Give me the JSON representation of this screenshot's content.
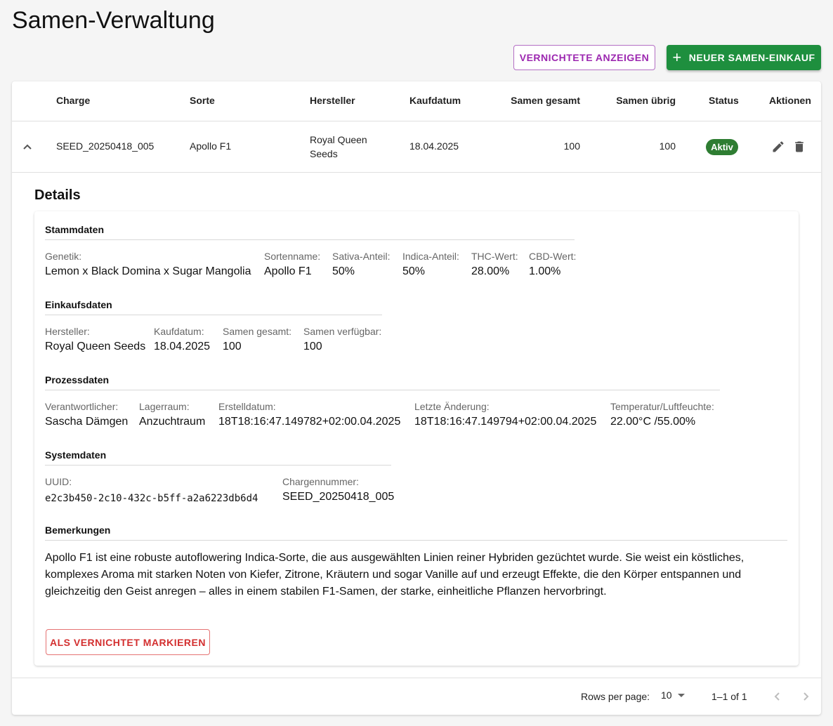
{
  "page": {
    "title": "Samen-Verwaltung"
  },
  "toolbar": {
    "show_destroyed_label": "Vernichtete anzeigen",
    "new_purchase_label": "Neuer Samen-Einkauf"
  },
  "table": {
    "headers": {
      "charge": "Charge",
      "sorte": "Sorte",
      "hersteller": "Hersteller",
      "kaufdatum": "Kaufdatum",
      "samen_gesamt": "Samen gesamt",
      "samen_uebrig": "Samen übrig",
      "status": "Status",
      "aktionen": "Aktionen"
    },
    "rows": [
      {
        "charge": "SEED_20250418_005",
        "sorte": "Apollo F1",
        "hersteller_line1": "Royal Queen",
        "hersteller_line2": "Seeds",
        "kaufdatum": "18.04.2025",
        "samen_gesamt": "100",
        "samen_uebrig": "100",
        "status": "Aktiv",
        "status_color": "#2e7d32"
      }
    ]
  },
  "details": {
    "title": "Details",
    "stammdaten": {
      "title": "Stammdaten",
      "genetik_label": "Genetik:",
      "genetik": "Lemon x Black Domina x Sugar Mangolia",
      "sortenname_label": "Sortenname:",
      "sortenname": "Apollo F1",
      "sativa_label": "Sativa-Anteil:",
      "sativa": "50%",
      "indica_label": "Indica-Anteil:",
      "indica": "50%",
      "thc_label": "THC-Wert:",
      "thc": "28.00%",
      "cbd_label": "CBD-Wert:",
      "cbd": "1.00%"
    },
    "einkaufsdaten": {
      "title": "Einkaufsdaten",
      "hersteller_label": "Hersteller:",
      "hersteller": "Royal Queen Seeds",
      "kaufdatum_label": "Kaufdatum:",
      "kaufdatum": "18.04.2025",
      "gesamt_label": "Samen gesamt:",
      "gesamt": "100",
      "verfuegbar_label": "Samen verfügbar:",
      "verfuegbar": "100"
    },
    "prozessdaten": {
      "title": "Prozessdaten",
      "verantwortlicher_label": "Verantwortlicher:",
      "verantwortlicher": "Sascha Dämgen",
      "lagerraum_label": "Lagerraum:",
      "lagerraum": "Anzuchtraum",
      "erstelldatum_label": "Erstelldatum:",
      "erstelldatum": "18T18:16:47.149782+02:00.04.2025",
      "aenderung_label": "Letzte Änderung:",
      "aenderung": "18T18:16:47.149794+02:00.04.2025",
      "klima_label": "Temperatur/Luftfeuchte:",
      "klima": "22.00°C /55.00%"
    },
    "systemdaten": {
      "title": "Systemdaten",
      "uuid_label": "UUID:",
      "uuid": "e2c3b450-2c10-432c-b5ff-a2a6223db6d4",
      "chargennummer_label": "Chargennummer:",
      "chargennummer": "SEED_20250418_005"
    },
    "bemerkungen": {
      "title": "Bemerkungen",
      "text": "Apollo F1 ist eine robuste autoflowering Indica-Sorte, die aus ausgewählten Linien reiner Hybriden gezüchtet wurde. Sie weist ein köstliches, komplexes Aroma mit starken Noten von Kiefer, Zitrone, Kräutern und sogar Vanille auf und erzeugt Effekte, die den Körper entspannen und gleichzeitig den Geist anregen – alles in einem stabilen F1-Samen, der starke, einheitliche Pflanzen hervorbringt."
    },
    "destroy_label": "Als vernichtet markieren"
  },
  "pagination": {
    "rows_per_page_label": "Rows per page:",
    "rows_per_page": "10",
    "range": "1–1 of 1"
  },
  "icons": {
    "expand": "chevron-up-icon",
    "edit": "pencil-icon",
    "delete": "trash-icon",
    "add": "plus-icon",
    "prev": "chevron-left-icon",
    "next": "chevron-right-icon"
  },
  "colors": {
    "primary_green": "#1e8f3e",
    "accent_purple": "#9c27b0",
    "danger_red": "#d32f2f"
  }
}
